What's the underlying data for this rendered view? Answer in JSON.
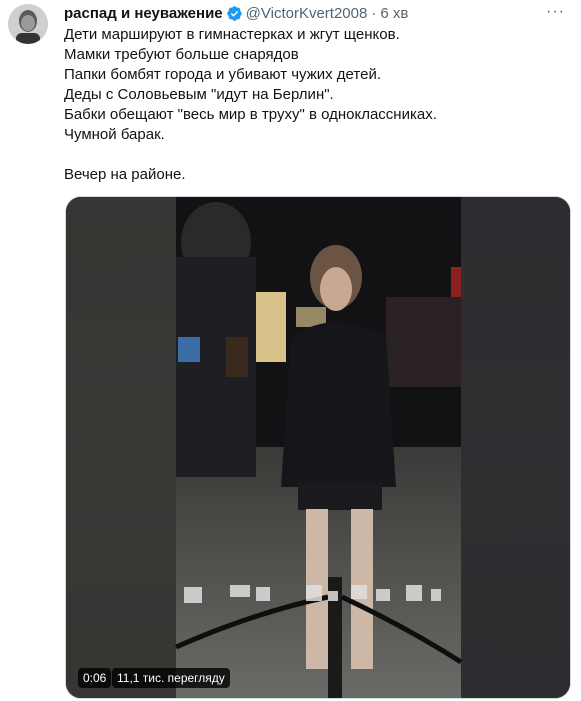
{
  "tweet": {
    "author_name": "распад и неуважение",
    "handle": "@VictorKvert2008",
    "separator": "·",
    "time": "6 хв",
    "lines": [
      "Дети маршируют в гимнастерках и жгут щенков.",
      "Мамки требуют больше снарядов",
      "Папки бомбят города и убивают чужих детей.",
      "Деды с Соловьевым \"идут на Берлин\".",
      "Бабки обещают \"весь мир в труху\" в одноклассниках.",
      "Чумной барак.",
      "",
      "Вечер на районе."
    ]
  },
  "video": {
    "duration": "0:06",
    "views": "11,1 тис. перегляду"
  },
  "colors": {
    "verified": "#1d9bf0",
    "secondary_text": "#536471",
    "primary_text": "#0f1419"
  },
  "icons": {
    "verified": "verified-badge-icon",
    "more": "more-options-icon"
  }
}
